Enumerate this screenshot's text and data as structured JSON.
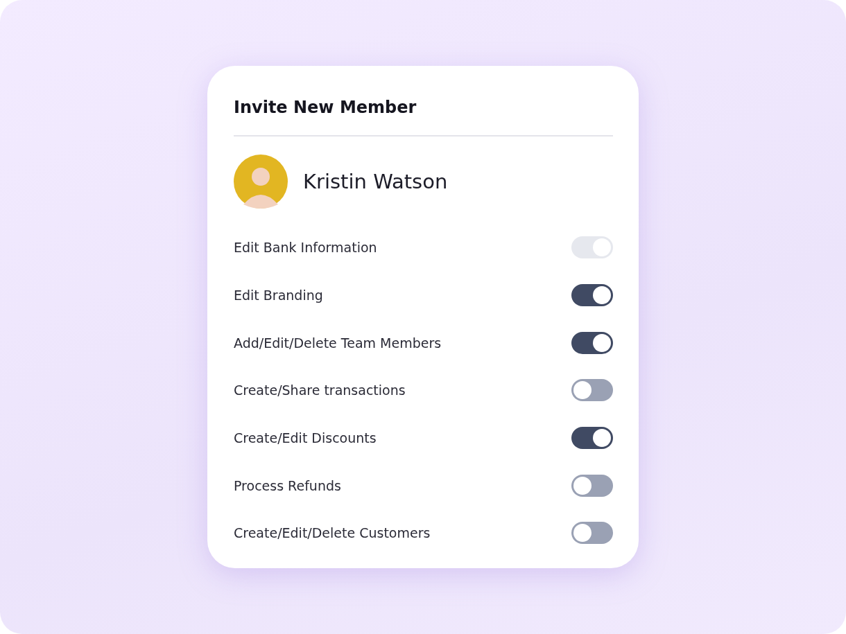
{
  "card": {
    "title": "Invite New Member",
    "member": {
      "name": "Kristin Watson"
    },
    "permissions": [
      {
        "label": "Edit Bank Information",
        "on": true,
        "disabled": true
      },
      {
        "label": "Edit Branding",
        "on": true,
        "disabled": false
      },
      {
        "label": "Add/Edit/Delete Team Members",
        "on": true,
        "disabled": false
      },
      {
        "label": "Create/Share transactions",
        "on": false,
        "disabled": false
      },
      {
        "label": "Create/Edit Discounts",
        "on": true,
        "disabled": false
      },
      {
        "label": "Process Refunds",
        "on": false,
        "disabled": false
      },
      {
        "label": "Create/Edit/Delete Customers",
        "on": false,
        "disabled": false
      }
    ]
  }
}
